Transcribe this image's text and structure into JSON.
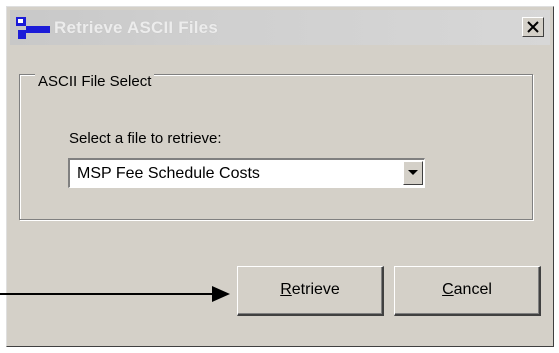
{
  "window": {
    "title": "Retrieve ASCII Files",
    "close_glyph": "x"
  },
  "group": {
    "legend": "ASCII File Select"
  },
  "file_select": {
    "label": "Select a file to retrieve:",
    "selected_value": "MSP Fee Schedule Costs"
  },
  "buttons": {
    "retrieve": {
      "accel": "R",
      "rest": "etrieve"
    },
    "cancel": {
      "accel": "C",
      "rest": "ancel"
    }
  },
  "icons": {
    "app": "app-icon",
    "close": "close-icon",
    "dropdown": "chevron-down-icon",
    "annotation": "arrow-right-icon"
  }
}
